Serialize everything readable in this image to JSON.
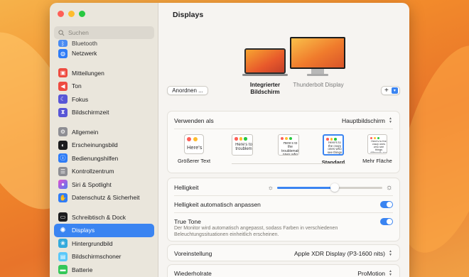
{
  "window": {
    "title": "Displays"
  },
  "sidebar": {
    "search_placeholder": "Suchen",
    "items": [
      {
        "label": "Bluetooth",
        "icon": "bluetooth-icon",
        "color": "#2f7cf6"
      },
      {
        "label": "Netzwerk",
        "icon": "globe-icon",
        "color": "#2f7cf6"
      },
      {
        "label": "Mitteilungen",
        "icon": "bell-icon",
        "color": "#ee4b40"
      },
      {
        "label": "Ton",
        "icon": "speaker-icon",
        "color": "#ee4b40"
      },
      {
        "label": "Fokus",
        "icon": "moon-icon",
        "color": "#5856d6"
      },
      {
        "label": "Bildschirmzeit",
        "icon": "hourglass-icon",
        "color": "#5856d6"
      },
      {
        "label": "Allgemein",
        "icon": "gear-icon",
        "color": "#8e8e93"
      },
      {
        "label": "Erscheinungsbild",
        "icon": "appearance-icon",
        "color": "#1c1c1e"
      },
      {
        "label": "Bedienungshilfen",
        "icon": "accessibility-icon",
        "color": "#2f7cf6"
      },
      {
        "label": "Kontrollzentrum",
        "icon": "control-center-icon",
        "color": "#8e8e93"
      },
      {
        "label": "Siri & Spotlight",
        "icon": "siri-icon",
        "color": "#8a4bd8"
      },
      {
        "label": "Datenschutz & Sicherheit",
        "icon": "hand-icon",
        "color": "#2f7cf6"
      },
      {
        "label": "Schreibtisch & Dock",
        "icon": "dock-icon",
        "color": "#1c1c1e"
      },
      {
        "label": "Displays",
        "icon": "sun-icon",
        "color": "#2f7cf6"
      },
      {
        "label": "Hintergrundbild",
        "icon": "wallpaper-icon",
        "color": "#34aadc"
      },
      {
        "label": "Bildschirmschoner",
        "icon": "screensaver-icon",
        "color": "#5ac8fa"
      },
      {
        "label": "Batterie",
        "icon": "battery-icon",
        "color": "#34c759"
      }
    ]
  },
  "displays": {
    "arrange_button": "Anordnen ...",
    "builtin_label": "Integrierter Bildschirm",
    "external_label": "Thunderbolt Display",
    "add_button": "+"
  },
  "settings": {
    "use_as_label": "Verwenden als",
    "use_as_value": "Hauptbildschirm",
    "resolution_options": [
      {
        "label": "Größerer Text",
        "sample": "Here's"
      },
      {
        "label": "",
        "sample": "Here's to troublem"
      },
      {
        "label": "",
        "sample": "Here's to the troublemak ones who"
      },
      {
        "label": "Standard",
        "sample": "Here's to the crazy ones who see things different"
      },
      {
        "label": "Mehr Fläche",
        "sample": "Here's to the crazy ones who see things differently and they have"
      }
    ],
    "brightness_label": "Helligkeit",
    "brightness_value": 0.55,
    "auto_brightness_label": "Helligkeit automatisch anpassen",
    "true_tone_label": "True Tone",
    "true_tone_desc": "Der Monitor wird automatisch angepasst, sodass Farben in verschiedenen Beleuchtungssituationen einheitlich erscheinen.",
    "preset_label": "Voreinstellung",
    "preset_value": "Apple XDR Display (P3-1600 nits)",
    "refresh_label": "Wiederholrate",
    "refresh_value": "ProMotion"
  },
  "colors": {
    "accent": "#3a84f1"
  }
}
